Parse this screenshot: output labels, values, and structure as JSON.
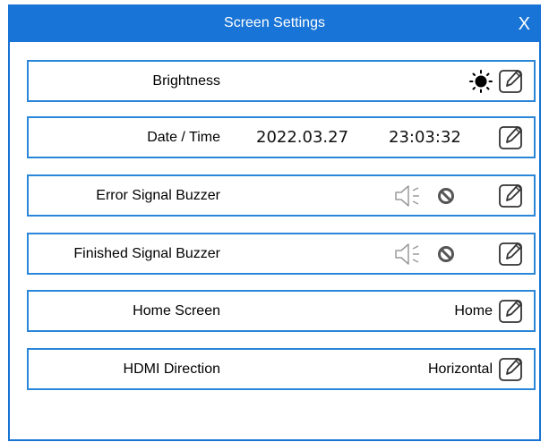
{
  "dialog": {
    "title": "Screen Settings",
    "close_label": "X"
  },
  "colors": {
    "titlebar": "#1874d6",
    "border": "#2a86d8"
  },
  "rows": {
    "brightness": {
      "label": "Brightness",
      "icon": "sun-icon"
    },
    "datetime": {
      "label": "Date / Time",
      "date": "2022.03.27",
      "time": "23:03:32"
    },
    "error_buzzer": {
      "label": "Error Signal Buzzer",
      "icons": [
        "speaker-icon",
        "disabled-icon"
      ]
    },
    "finished_buzzer": {
      "label": "Finished Signal Buzzer",
      "icons": [
        "speaker-icon",
        "disabled-icon"
      ]
    },
    "home_screen": {
      "label": "Home Screen",
      "value": "Home"
    },
    "hdmi_direction": {
      "label": "HDMI Direction",
      "value": "Horizontal"
    }
  },
  "edit_icon": "pencil-edit-icon"
}
